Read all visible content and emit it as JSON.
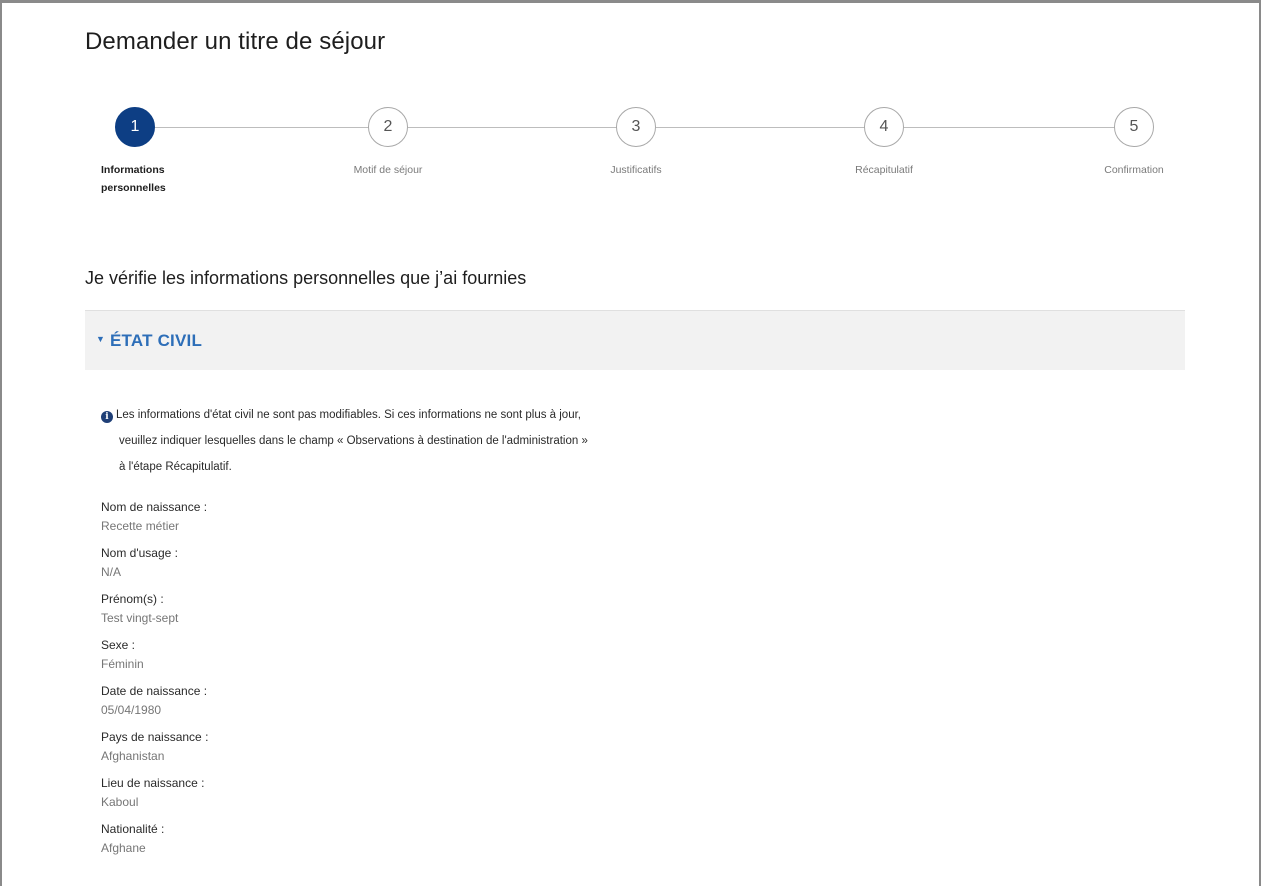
{
  "page": {
    "title": "Demander un titre de séjour"
  },
  "stepper": {
    "steps": [
      {
        "number": "1",
        "label": "Informations personnelles",
        "active": true
      },
      {
        "number": "2",
        "label": "Motif de séjour",
        "active": false
      },
      {
        "number": "3",
        "label": "Justificatifs",
        "active": false
      },
      {
        "number": "4",
        "label": "Récapitulatif",
        "active": false
      },
      {
        "number": "5",
        "label": "Confirmation",
        "active": false
      }
    ],
    "label_line1": "Informations",
    "label_line2": "personnelles"
  },
  "section": {
    "title": "Je vérifie les informations personnelles que j’ai fournies"
  },
  "accordion": {
    "title": "ÉTAT CIVIL",
    "expanded": true
  },
  "info": {
    "line1": "Les informations d'état civil ne sont pas modifiables. Si ces informations ne sont plus à jour,",
    "line2": "veuillez indiquer lesquelles dans le champ « Observations à destination de l'administration »",
    "line3": "à l'étape Récapitulatif."
  },
  "fields": [
    {
      "label": "Nom de naissance :",
      "value": "Recette métier"
    },
    {
      "label": "Nom d'usage :",
      "value": "N/A"
    },
    {
      "label": "Prénom(s) :",
      "value": "Test vingt-sept"
    },
    {
      "label": "Sexe :",
      "value": "Féminin"
    },
    {
      "label": "Date de naissance :",
      "value": "05/04/1980"
    },
    {
      "label": "Pays de naissance :",
      "value": "Afghanistan"
    },
    {
      "label": "Lieu de naissance :",
      "value": "Kaboul"
    },
    {
      "label": "Nationalité :",
      "value": "Afghane"
    }
  ],
  "colors": {
    "primary": "#0d3e84",
    "accordion_title": "#2d6eb8",
    "accordion_bg": "#f2f2f2",
    "value_text": "#767676"
  }
}
